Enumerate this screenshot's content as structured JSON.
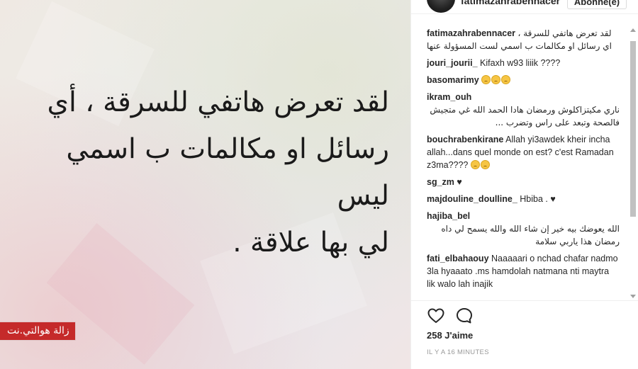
{
  "image_post": {
    "arabic_text_lines": [
      "لقد تعرض هاتفي للسرقة ، أي",
      "رسائل او مكالمات ب اسمي ليس",
      "لي بها علاقة ."
    ],
    "watermark": "زالة هوالتي.نت"
  },
  "header": {
    "username": "fatimazahrabennacer",
    "follow_label": "Abonné(e)"
  },
  "comments": [
    {
      "author": "fatimazahrabennacer",
      "text": "لقد تعرض هاتفي للسرقة ، اي رسائل او مكالمات ب اسمي لست المسؤولة عنها",
      "rtl": true
    },
    {
      "author": "jouri_jourii_",
      "text": "Kifaxh w93 liiik ????",
      "rtl": false
    },
    {
      "author": "basomarimy",
      "text": "",
      "emojis": 3,
      "rtl": false
    },
    {
      "author": "ikram_ouh",
      "text": "ناري مكيتزاكلوش ورمضان هادا الحمد الله غي متجيش فالصحة وتبعد على راس وتضرب ...",
      "rtl": true
    },
    {
      "author": "bouchrabenkirane",
      "text": "Allah yi3awdek kheir incha allah...dans quel monde on est? c'est Ramadan z3ma????",
      "emojis_after": 2,
      "rtl": false
    },
    {
      "author": "sg_zm",
      "text": "♥",
      "rtl": false
    },
    {
      "author": "majdouline_doulline_",
      "text": "Hbiba . ♥",
      "rtl": false
    },
    {
      "author": "hajiba_bel",
      "text": "الله يعوضك بيه خير إن شاء الله والله يسمح لي داه رمضان هذا ياربي سلامة",
      "rtl": true
    },
    {
      "author": "fati_elbahaouy",
      "text": "Naaaaari o nchad chafar nadmo 3la hyaaato .ms hamdolah natmana nti maytra lik walo lah inajik",
      "rtl": false
    }
  ],
  "actions": {
    "like_icon": "heart-outline-icon",
    "comment_icon": "speech-bubble-icon",
    "likes_text": "258 J'aime",
    "timestamp": "IL Y A 16 MINUTES"
  }
}
